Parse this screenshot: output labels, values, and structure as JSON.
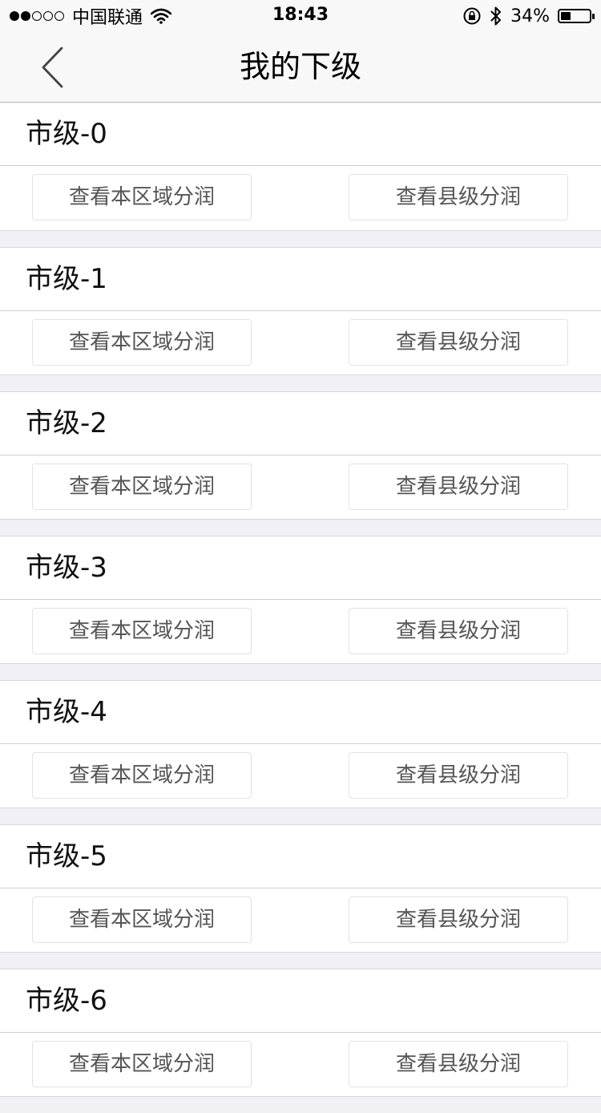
{
  "status_bar": {
    "carrier": "中国联通",
    "time": "18:43",
    "battery_text": "34%",
    "battery_level": 0.34
  },
  "nav": {
    "title": "我的下级"
  },
  "sections": [
    {
      "title": "市级-0",
      "btn_left": "查看本区域分润",
      "btn_right": "查看县级分润"
    },
    {
      "title": "市级-1",
      "btn_left": "查看本区域分润",
      "btn_right": "查看县级分润"
    },
    {
      "title": "市级-2",
      "btn_left": "查看本区域分润",
      "btn_right": "查看县级分润"
    },
    {
      "title": "市级-3",
      "btn_left": "查看本区域分润",
      "btn_right": "查看县级分润"
    },
    {
      "title": "市级-4",
      "btn_left": "查看本区域分润",
      "btn_right": "查看县级分润"
    },
    {
      "title": "市级-5",
      "btn_left": "查看本区域分润",
      "btn_right": "查看县级分润"
    },
    {
      "title": "市级-6",
      "btn_left": "查看本区域分润",
      "btn_right": "查看县级分润"
    }
  ]
}
